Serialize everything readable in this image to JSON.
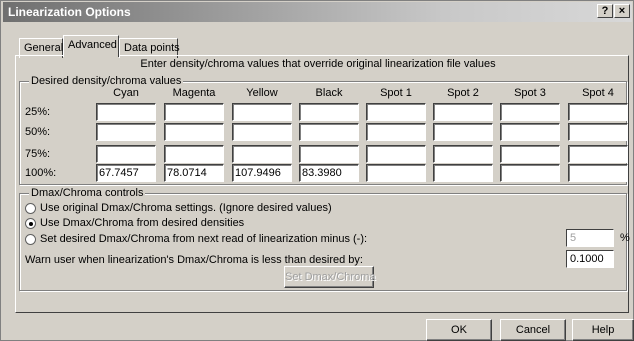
{
  "window": {
    "title": "Linearization Options",
    "help_btn": "?",
    "close_btn": "×"
  },
  "tabs": [
    {
      "label": "General"
    },
    {
      "label": "Advanced"
    },
    {
      "label": "Data points"
    }
  ],
  "instructions": "Enter density/chroma values that override original linearization file values",
  "desired": {
    "group_label": "Desired density/chroma values",
    "columns": [
      "Cyan",
      "Magenta",
      "Yellow",
      "Black",
      "Spot 1",
      "Spot 2",
      "Spot 3",
      "Spot 4"
    ],
    "rows": [
      {
        "label": "25%:",
        "values": [
          "",
          "",
          "",
          "",
          "",
          "",
          "",
          ""
        ]
      },
      {
        "label": "50%:",
        "values": [
          "",
          "",
          "",
          "",
          "",
          "",
          "",
          ""
        ]
      },
      {
        "label": "75%:",
        "values": [
          "",
          "",
          "",
          "",
          "",
          "",
          "",
          ""
        ]
      },
      {
        "label": "100%:",
        "values": [
          "67.7457",
          "78.0714",
          "107.9496",
          "83.3980",
          "",
          "",
          "",
          ""
        ]
      }
    ]
  },
  "dmax": {
    "group_label": "Dmax/Chroma controls",
    "options": [
      {
        "label": "Use original Dmax/Chroma settings. (Ignore desired values)",
        "selected": false
      },
      {
        "label": "Use Dmax/Chroma from desired densities",
        "selected": true
      },
      {
        "label": "Set desired Dmax/Chroma from next read of linearization minus (-):",
        "selected": false
      }
    ],
    "minus_value": "5",
    "percent_label": "%",
    "warn_label": "Warn user when linearization's Dmax/Chroma is less than desired by:",
    "warn_value": "0.1000",
    "set_button": "Set Dmax/Chroma"
  },
  "buttons": {
    "ok": "OK",
    "cancel": "Cancel",
    "help": "Help"
  }
}
